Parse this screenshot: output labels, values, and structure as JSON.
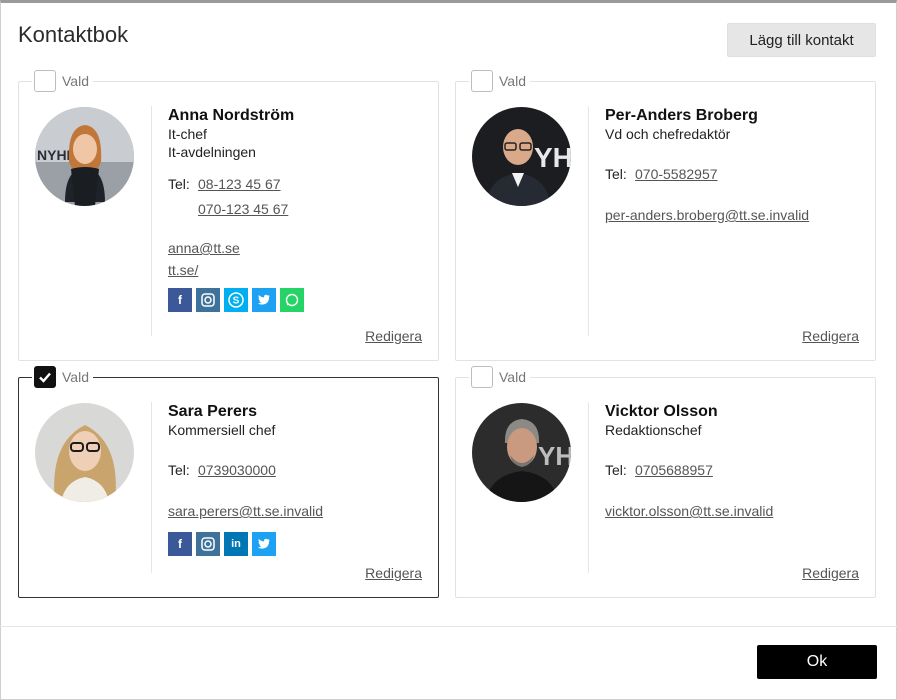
{
  "dialog": {
    "title": "Kontaktbok",
    "add_button": "Lägg till kontakt",
    "ok_button": "Ok"
  },
  "common": {
    "selected_label": "Vald",
    "tel_label": "Tel:",
    "edit_label": "Redigera"
  },
  "contacts": [
    {
      "name": "Anna Nordström",
      "title": "It-chef",
      "department": "It-avdelningen",
      "phones": [
        "08-123 45 67",
        "070-123 45 67"
      ],
      "email": "anna@tt.se",
      "website": "tt.se/",
      "selected": false,
      "social": [
        "facebook-icon",
        "instagram-icon",
        "skype-icon",
        "twitter-icon",
        "whatsapp-icon"
      ]
    },
    {
      "name": "Per-Anders Broberg",
      "title": "Vd och chefredaktör",
      "phones": [
        "070-5582957"
      ],
      "email": "per-anders.broberg@tt.se.invalid",
      "selected": false
    },
    {
      "name": "Sara Perers",
      "title": "Kommersiell chef",
      "phones": [
        "0739030000"
      ],
      "email": "sara.perers@tt.se.invalid",
      "selected": true,
      "social": [
        "facebook-icon",
        "instagram-icon",
        "linkedin-icon",
        "twitter-icon"
      ]
    },
    {
      "name": "Vicktor Olsson",
      "title": "Redaktionschef",
      "phones": [
        "0705688957"
      ],
      "email": "vicktor.olsson@tt.se.invalid",
      "selected": false
    }
  ],
  "colors": {
    "facebook": "#3b5998",
    "instagram": "#3f729b",
    "skype": "#00aff0",
    "twitter": "#1da1f2",
    "whatsapp": "#25d366",
    "linkedin": "#0077b5"
  }
}
